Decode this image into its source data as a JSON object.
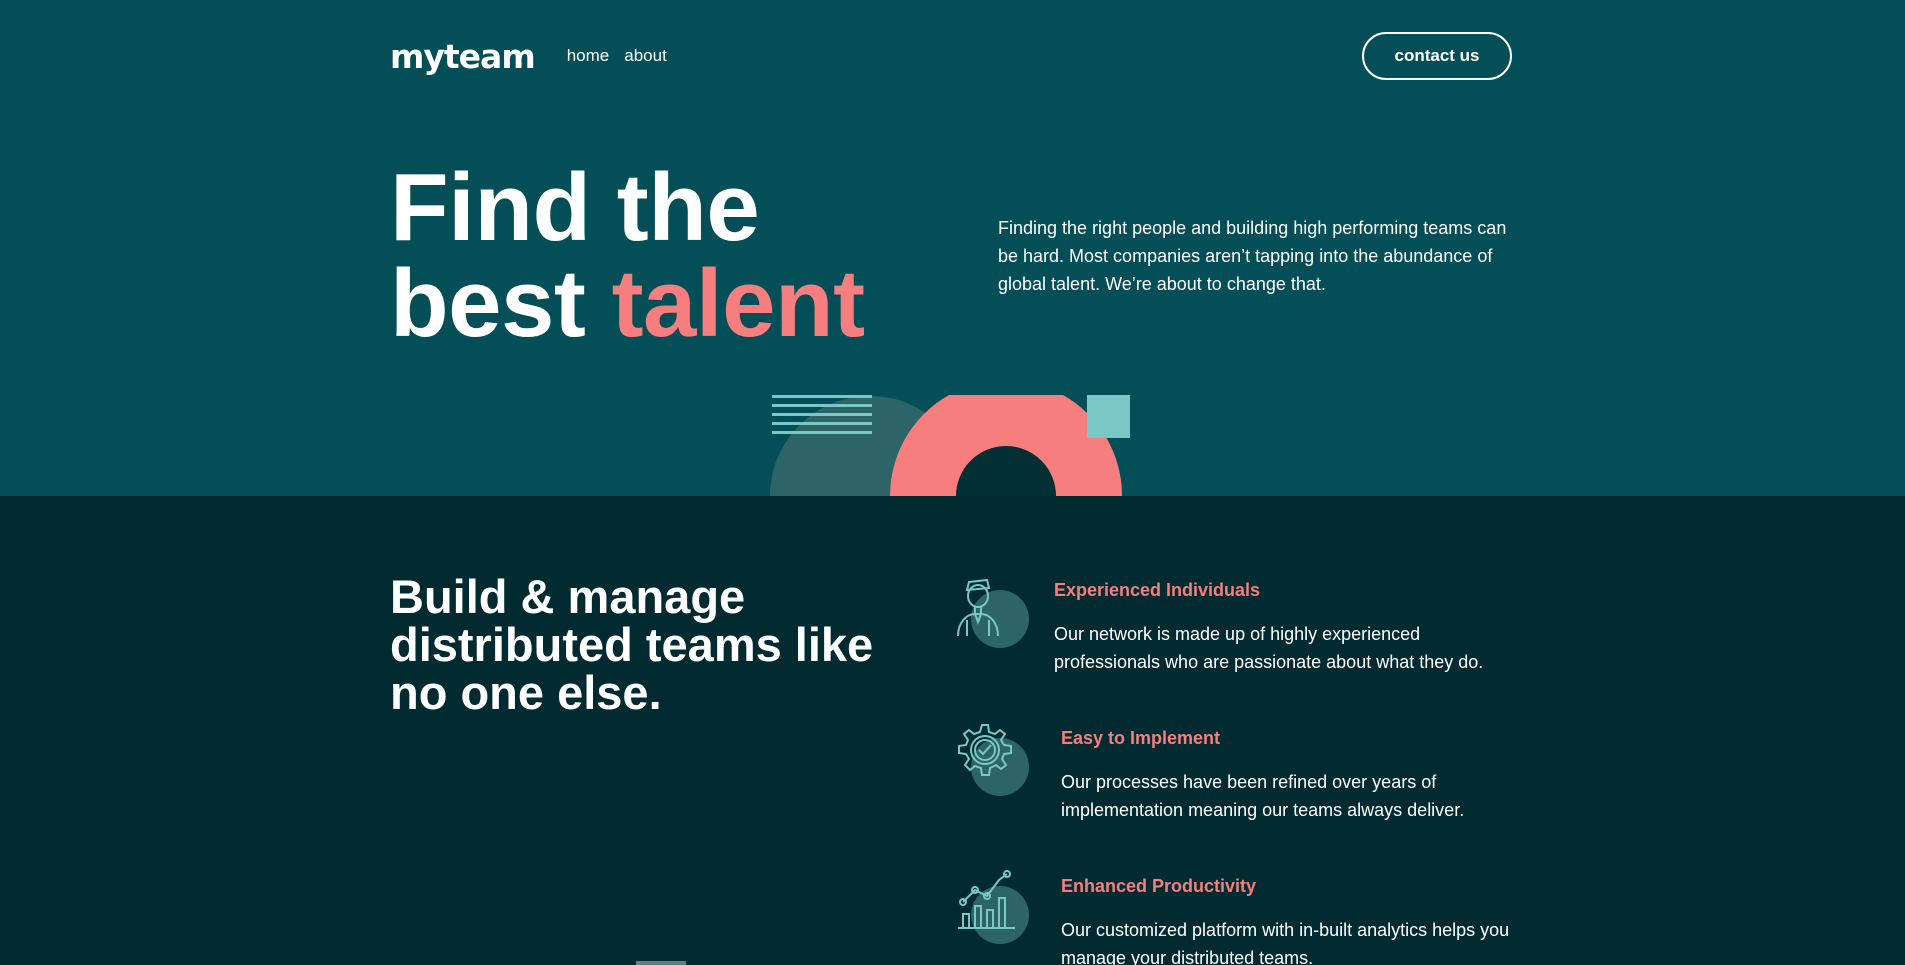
{
  "nav": {
    "logo": "myteam",
    "links": [
      "home",
      "about"
    ],
    "contact_label": "contact us"
  },
  "hero": {
    "title_line1": "Find the",
    "title_line2_prefix": "best ",
    "title_accent": "talent",
    "description": "Finding the right people and building high performing teams can be hard. Most companies aren’t tapping into the abundance of global talent. We’re about to change that."
  },
  "features": {
    "heading": "Build & manage distributed teams like no one else.",
    "items": [
      {
        "icon": "person-icon",
        "title": "Experienced Individuals",
        "description": "Our network is made up of highly experienced professionals who are passionate about what they do."
      },
      {
        "icon": "gear-check-icon",
        "title": "Easy to Implement",
        "description": "Our processes have been refined over years of implementation meaning our teams always deliver."
      },
      {
        "icon": "chart-icon",
        "title": "Enhanced Productivity",
        "description": "Our customized platform with in-built analytics helps you manage your distributed teams."
      }
    ]
  },
  "colors": {
    "hero_bg": "#044f57",
    "features_bg": "#022b31",
    "accent": "#f67e7e",
    "teal": "#79c8c7"
  }
}
